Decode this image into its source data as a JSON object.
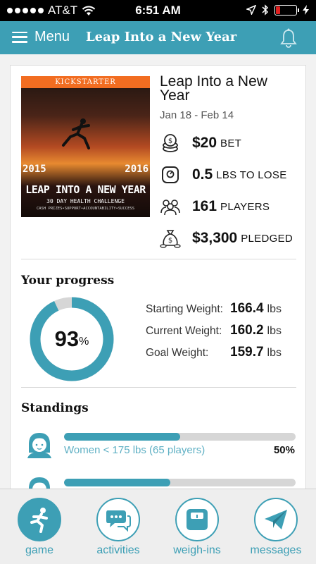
{
  "status_bar": {
    "carrier": "AT&T",
    "time": "6:51 AM"
  },
  "header": {
    "menu_label": "Menu",
    "title": "Leap Into a New Year"
  },
  "challenge": {
    "image": {
      "banner": "KICKSTARTER",
      "year_left": "2015",
      "year_right": "2016",
      "headline": "LEAP INTO A NEW YEAR",
      "subtitle": "30 DAY HEALTH CHALLENGE",
      "tagline": "CASH PRIZES•SUPPORT•ACCOUNTABILITY•SUCCESS"
    },
    "title": "Leap Into a New Year",
    "dates": "Jan 18 - Feb 14",
    "stats": [
      {
        "icon": "coins-icon",
        "value": "$20",
        "unit": "BET"
      },
      {
        "icon": "scale-icon",
        "value": "0.5",
        "unit": "LBS TO LOSE"
      },
      {
        "icon": "players-icon",
        "value": "161",
        "unit": "PLAYERS"
      },
      {
        "icon": "money-bag-icon",
        "value": "$3,300",
        "unit": "PLEDGED"
      }
    ]
  },
  "progress": {
    "heading": "Your progress",
    "percent": 93,
    "percent_text": "93",
    "percent_sign": "%",
    "rows": [
      {
        "label": "Starting Weight:",
        "value": "166.4",
        "unit": "lbs"
      },
      {
        "label": "Current Weight:",
        "value": "160.2",
        "unit": "lbs"
      },
      {
        "label": "Goal Weight:",
        "value": "159.7",
        "unit": "lbs"
      }
    ]
  },
  "standings": {
    "heading": "Standings",
    "items": [
      {
        "label": "Women < 175 lbs (65 players)",
        "percent_text": "50%",
        "fill": 0.5
      },
      {
        "label": "",
        "percent_text": "",
        "fill": 0.46
      }
    ]
  },
  "nav": {
    "items": [
      {
        "label": "game",
        "icon": "runner-icon",
        "active": true
      },
      {
        "label": "activities",
        "icon": "chat-bubbles-icon",
        "active": false
      },
      {
        "label": "weigh-ins",
        "icon": "scale-icon",
        "active": false
      },
      {
        "label": "messages",
        "icon": "paper-plane-icon",
        "active": false
      }
    ]
  },
  "colors": {
    "accent": "#3d9fb5",
    "banner": "#f26d21",
    "battery_low": "#e02020"
  }
}
